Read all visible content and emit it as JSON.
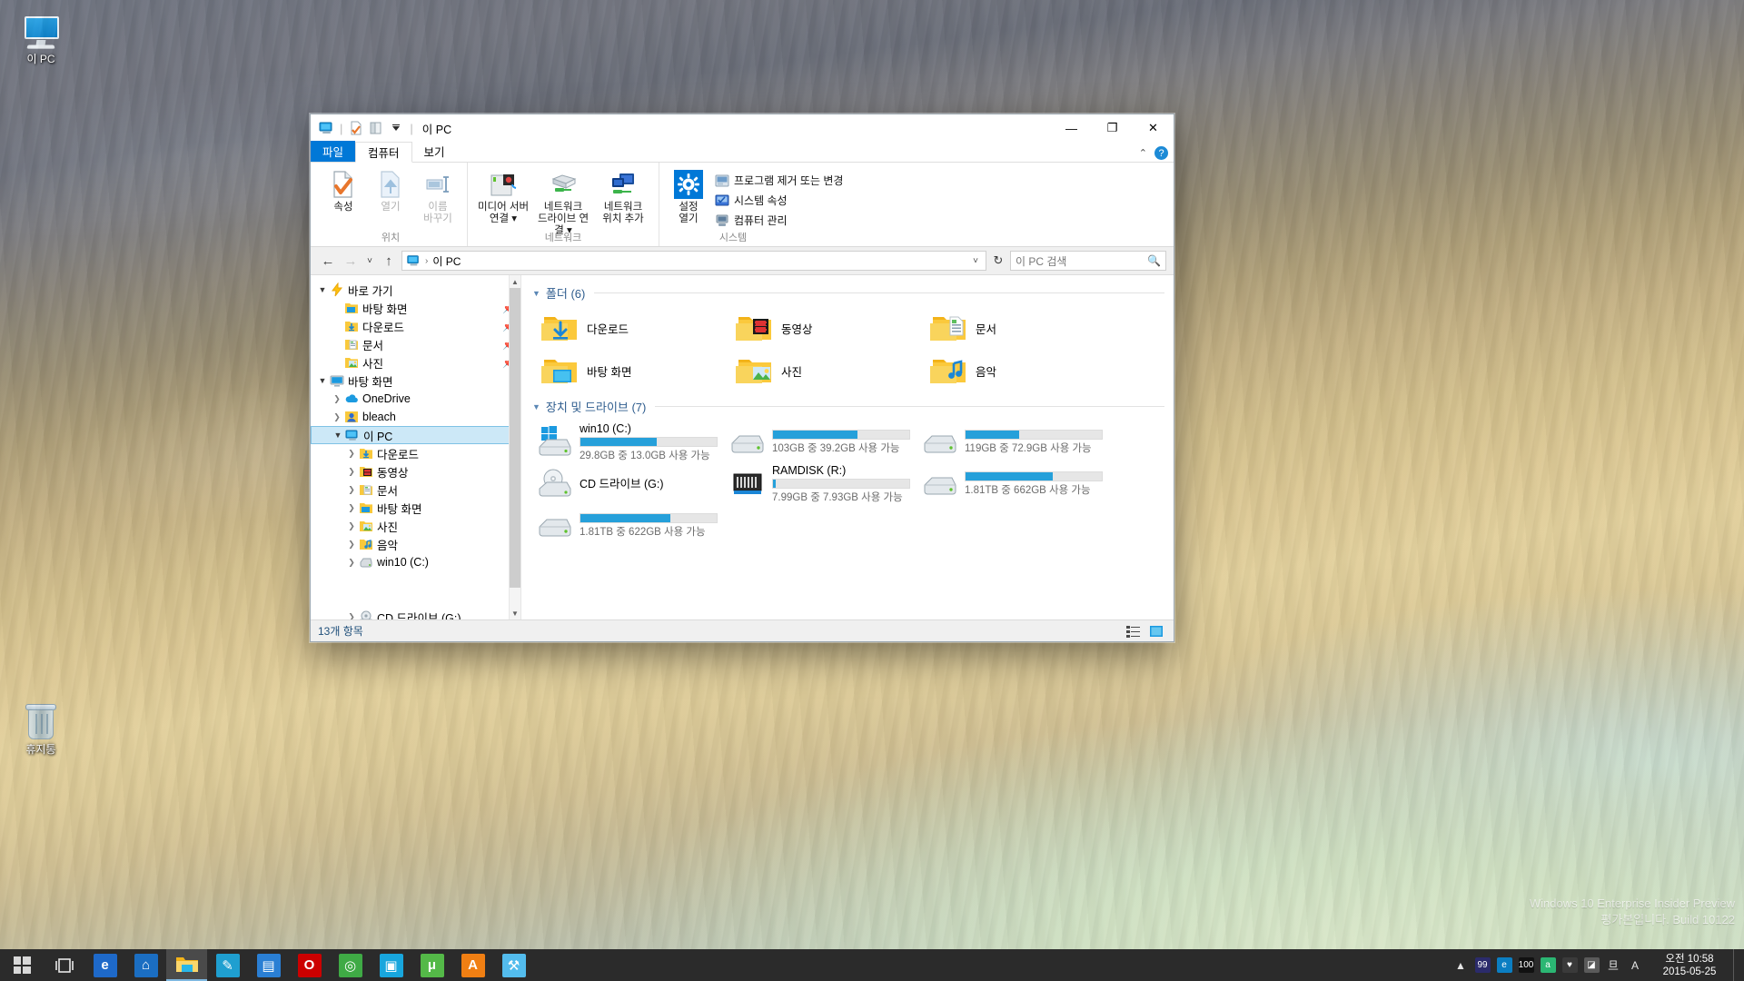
{
  "desktop": {
    "icons": [
      {
        "name": "this-pc",
        "label": "이 PC"
      },
      {
        "name": "recycle-bin",
        "label": "휴지통"
      }
    ],
    "watermark_line1": "Windows 10 Enterprise Insider Preview",
    "watermark_line2": "평가본입니다. Build 10122"
  },
  "window": {
    "title": "이 PC",
    "quick_access": [
      "this-pc-icon",
      "properties-icon",
      "new-folder-icon",
      "customize-chevron-icon"
    ],
    "controls": {
      "minimize": "—",
      "maximize": "❐",
      "close": "✕"
    }
  },
  "tabs": [
    {
      "label": "파일",
      "name": "tab-file",
      "kind": "file"
    },
    {
      "label": "컴퓨터",
      "name": "tab-computer",
      "kind": "active"
    },
    {
      "label": "보기",
      "name": "tab-view",
      "kind": "normal"
    }
  ],
  "ribbon": {
    "collapse_icon": "chevron-up-icon",
    "help_icon": "help-icon",
    "groups": [
      {
        "title": "위치",
        "name": "ribbon-group-location",
        "buttons": [
          {
            "label": "속성",
            "name": "properties-button",
            "icon": "properties-icon",
            "disabled": false
          },
          {
            "label": "열기",
            "name": "open-button",
            "icon": "open-icon",
            "disabled": true
          },
          {
            "label": "이름\n바꾸기",
            "name": "rename-button",
            "icon": "rename-icon",
            "disabled": true
          }
        ]
      },
      {
        "title": "네트워크",
        "name": "ribbon-group-network",
        "buttons": [
          {
            "label": "미디어 서버\n연결 ▾",
            "name": "media-server-connect-button",
            "icon": "media-server-icon",
            "disabled": false
          },
          {
            "label": "네트워크\n드라이브 연결 ▾",
            "name": "map-network-drive-button",
            "icon": "network-drive-icon",
            "disabled": false
          },
          {
            "label": "네트워크\n위치 추가",
            "name": "add-network-location-button",
            "icon": "network-location-icon",
            "disabled": false
          }
        ]
      },
      {
        "title": "시스템",
        "name": "ribbon-group-system",
        "buttons": [
          {
            "label": "설정\n열기",
            "name": "open-settings-button",
            "icon": "gear-icon",
            "disabled": false
          }
        ],
        "list": [
          {
            "label": "프로그램 제거 또는 변경",
            "name": "uninstall-change-program-item",
            "icon": "uninstall-icon"
          },
          {
            "label": "시스템 속성",
            "name": "system-properties-item",
            "icon": "system-properties-icon"
          },
          {
            "label": "컴퓨터 관리",
            "name": "computer-management-item",
            "icon": "computer-management-icon"
          }
        ]
      }
    ]
  },
  "addressbar": {
    "back": "←",
    "forward": "→",
    "recent": "˅",
    "up": "↑",
    "root_icon": "this-pc-icon",
    "crumb_sep": "›",
    "path": "이 PC",
    "dropdown": "˅",
    "refresh": "↻"
  },
  "search": {
    "placeholder": "이 PC 검색",
    "icon": "search-icon"
  },
  "navpane": {
    "items": [
      {
        "label": "바로 가기",
        "icon": "quick-access-icon",
        "indent": 0,
        "expander": "open",
        "pinned": false,
        "selected": false,
        "name": "nav-quick-access"
      },
      {
        "label": "바탕 화면",
        "icon": "desktop-folder-icon",
        "indent": 1,
        "expander": "none",
        "pinned": true,
        "selected": false,
        "name": "nav-desktop-pinned"
      },
      {
        "label": "다운로드",
        "icon": "downloads-folder-icon",
        "indent": 1,
        "expander": "none",
        "pinned": true,
        "selected": false,
        "name": "nav-downloads-pinned"
      },
      {
        "label": "문서",
        "icon": "documents-folder-icon",
        "indent": 1,
        "expander": "none",
        "pinned": true,
        "selected": false,
        "name": "nav-documents-pinned"
      },
      {
        "label": "사진",
        "icon": "pictures-folder-icon",
        "indent": 1,
        "expander": "none",
        "pinned": true,
        "selected": false,
        "name": "nav-pictures-pinned"
      },
      {
        "label": "바탕 화면",
        "icon": "desktop-icon",
        "indent": 0,
        "expander": "open",
        "pinned": false,
        "selected": false,
        "name": "nav-desktop-root"
      },
      {
        "label": "OneDrive",
        "icon": "onedrive-icon",
        "indent": 1,
        "expander": "closed",
        "pinned": false,
        "selected": false,
        "name": "nav-onedrive"
      },
      {
        "label": "bleach",
        "icon": "user-icon",
        "indent": 1,
        "expander": "closed",
        "pinned": false,
        "selected": false,
        "name": "nav-user-bleach"
      },
      {
        "label": "이 PC",
        "icon": "this-pc-icon",
        "indent": 1,
        "expander": "open",
        "pinned": false,
        "selected": true,
        "name": "nav-this-pc"
      },
      {
        "label": "다운로드",
        "icon": "downloads-folder-icon",
        "indent": 2,
        "expander": "closed",
        "pinned": false,
        "selected": false,
        "name": "nav-this-pc-downloads"
      },
      {
        "label": "동영상",
        "icon": "videos-folder-icon",
        "indent": 2,
        "expander": "closed",
        "pinned": false,
        "selected": false,
        "name": "nav-this-pc-videos"
      },
      {
        "label": "문서",
        "icon": "documents-folder-icon",
        "indent": 2,
        "expander": "closed",
        "pinned": false,
        "selected": false,
        "name": "nav-this-pc-documents"
      },
      {
        "label": "바탕 화면",
        "icon": "desktop-folder-icon",
        "indent": 2,
        "expander": "closed",
        "pinned": false,
        "selected": false,
        "name": "nav-this-pc-desktop"
      },
      {
        "label": "사진",
        "icon": "pictures-folder-icon",
        "indent": 2,
        "expander": "closed",
        "pinned": false,
        "selected": false,
        "name": "nav-this-pc-pictures"
      },
      {
        "label": "음악",
        "icon": "music-folder-icon",
        "indent": 2,
        "expander": "closed",
        "pinned": false,
        "selected": false,
        "name": "nav-this-pc-music"
      },
      {
        "label": "win10 (C:)",
        "icon": "hdd-icon",
        "indent": 2,
        "expander": "closed",
        "pinned": false,
        "selected": false,
        "name": "nav-drive-c"
      },
      {
        "label": "",
        "icon": "none",
        "indent": 0,
        "expander": "none",
        "pinned": false,
        "selected": false,
        "name": "nav-spacer-1"
      },
      {
        "label": "",
        "icon": "none",
        "indent": 0,
        "expander": "none",
        "pinned": false,
        "selected": false,
        "name": "nav-spacer-2"
      },
      {
        "label": "CD 드라이브 (G:)",
        "icon": "cd-icon",
        "indent": 2,
        "expander": "closed",
        "pinned": false,
        "selected": false,
        "name": "nav-drive-g"
      },
      {
        "label": "RAMDISK (R:)",
        "icon": "ramdisk-icon",
        "indent": 2,
        "expander": "closed",
        "pinned": false,
        "selected": false,
        "name": "nav-drive-r"
      }
    ]
  },
  "content": {
    "folders_group": {
      "label": "폴더 (6)",
      "name": "group-folders"
    },
    "folders": [
      {
        "label": "다운로드",
        "icon": "downloads-folder-icon",
        "name": "folder-downloads"
      },
      {
        "label": "동영상",
        "icon": "videos-folder-icon",
        "name": "folder-videos"
      },
      {
        "label": "문서",
        "icon": "documents-folder-icon",
        "name": "folder-documents"
      },
      {
        "label": "바탕 화면",
        "icon": "desktop-folder-icon",
        "name": "folder-desktop"
      },
      {
        "label": "사진",
        "icon": "pictures-folder-icon",
        "name": "folder-pictures"
      },
      {
        "label": "음악",
        "icon": "music-folder-icon",
        "name": "folder-music"
      }
    ],
    "drives_group": {
      "label": "장치 및 드라이브 (7)",
      "name": "group-drives"
    },
    "drives": [
      {
        "name": "drive-win10-c",
        "label": "win10 (C:)",
        "icon": "windows-drive-icon",
        "capacity": "29.8GB 중 13.0GB 사용 가능",
        "fill_percent": 56,
        "show_bar": true,
        "show_label": true
      },
      {
        "name": "drive-d",
        "label": "",
        "icon": "hdd-icon",
        "capacity": "103GB 중 39.2GB 사용 가능",
        "fill_percent": 62,
        "show_bar": true,
        "show_label": false
      },
      {
        "name": "drive-e",
        "label": "",
        "icon": "hdd-icon",
        "capacity": "119GB 중 72.9GB 사용 가능",
        "fill_percent": 39,
        "show_bar": true,
        "show_label": false
      },
      {
        "name": "drive-cd-g",
        "label": "CD 드라이브 (G:)",
        "icon": "cd-icon",
        "capacity": "",
        "fill_percent": 0,
        "show_bar": false,
        "show_label": true
      },
      {
        "name": "drive-ramdisk-r",
        "label": "RAMDISK (R:)",
        "icon": "ramdisk-icon",
        "capacity": "7.99GB 중 7.93GB 사용 가능",
        "fill_percent": 2,
        "show_bar": true,
        "show_label": true
      },
      {
        "name": "drive-f",
        "label": "",
        "icon": "hdd-icon",
        "capacity": "1.81TB 중 662GB 사용 가능",
        "fill_percent": 64,
        "show_bar": true,
        "show_label": false
      },
      {
        "name": "drive-h",
        "label": "",
        "icon": "hdd-icon",
        "capacity": "1.81TB 중 622GB 사용 가능",
        "fill_percent": 66,
        "show_bar": true,
        "show_label": false
      }
    ]
  },
  "statusbar": {
    "text": "13개 항목",
    "views": [
      {
        "name": "details-view-button",
        "icon": "details-view-icon"
      },
      {
        "name": "large-icons-view-button",
        "icon": "large-icons-view-icon"
      }
    ]
  },
  "taskbar": {
    "start": "start-icon",
    "taskview": "task-view-icon",
    "apps": [
      {
        "name": "taskbar-internet-explorer",
        "glyph": "e",
        "color": "#1e69c9",
        "running": false
      },
      {
        "name": "taskbar-store",
        "glyph": "⌂",
        "color": "#1b6ec2",
        "running": false
      },
      {
        "name": "taskbar-file-explorer",
        "glyph": "📁",
        "color": "#f5c23a",
        "running": true
      },
      {
        "name": "taskbar-editor",
        "glyph": "✎",
        "color": "#1f9fd0",
        "running": false
      },
      {
        "name": "taskbar-notes",
        "glyph": "▤",
        "color": "#2a7fd4",
        "running": false
      },
      {
        "name": "taskbar-opera",
        "glyph": "O",
        "color": "#cc0000",
        "running": false
      },
      {
        "name": "taskbar-sync",
        "glyph": "◎",
        "color": "#3faa45",
        "running": false
      },
      {
        "name": "taskbar-media",
        "glyph": "▣",
        "color": "#18a6dd",
        "running": false
      },
      {
        "name": "taskbar-utorrent",
        "glyph": "μ",
        "color": "#54b948",
        "running": false
      },
      {
        "name": "taskbar-acrobat",
        "glyph": "A",
        "color": "#f07f13",
        "running": false
      },
      {
        "name": "taskbar-tools",
        "glyph": "⚒",
        "color": "#53bced",
        "running": false
      }
    ],
    "tray": [
      {
        "name": "tray-show-hidden-icons",
        "glyph": "▲",
        "color": "transparent"
      },
      {
        "name": "tray-monitor-icon",
        "glyph": "99",
        "color": "#2b2b6b"
      },
      {
        "name": "tray-edge-icon",
        "glyph": "e",
        "color": "#0b7ec2"
      },
      {
        "name": "tray-clock-widget-icon",
        "glyph": "100",
        "color": "#111111"
      },
      {
        "name": "tray-antivirus-icon",
        "glyph": "a",
        "color": "#2bb673"
      },
      {
        "name": "tray-capture-icon",
        "glyph": "♥",
        "color": "#3a3a3a"
      },
      {
        "name": "tray-nvidia-icon",
        "glyph": "◪",
        "color": "#5a5a5a"
      },
      {
        "name": "tray-network-icon",
        "glyph": "旦",
        "color": "transparent"
      },
      {
        "name": "tray-ime-icon",
        "glyph": "A",
        "color": "transparent"
      }
    ],
    "clock_time": "오전 10:58",
    "clock_date": "2015-05-25"
  },
  "colors": {
    "accent": "#0078d7",
    "bar_fill": "#26a0da",
    "group_header": "#2f5d8e",
    "selection": "#cce8f7"
  }
}
